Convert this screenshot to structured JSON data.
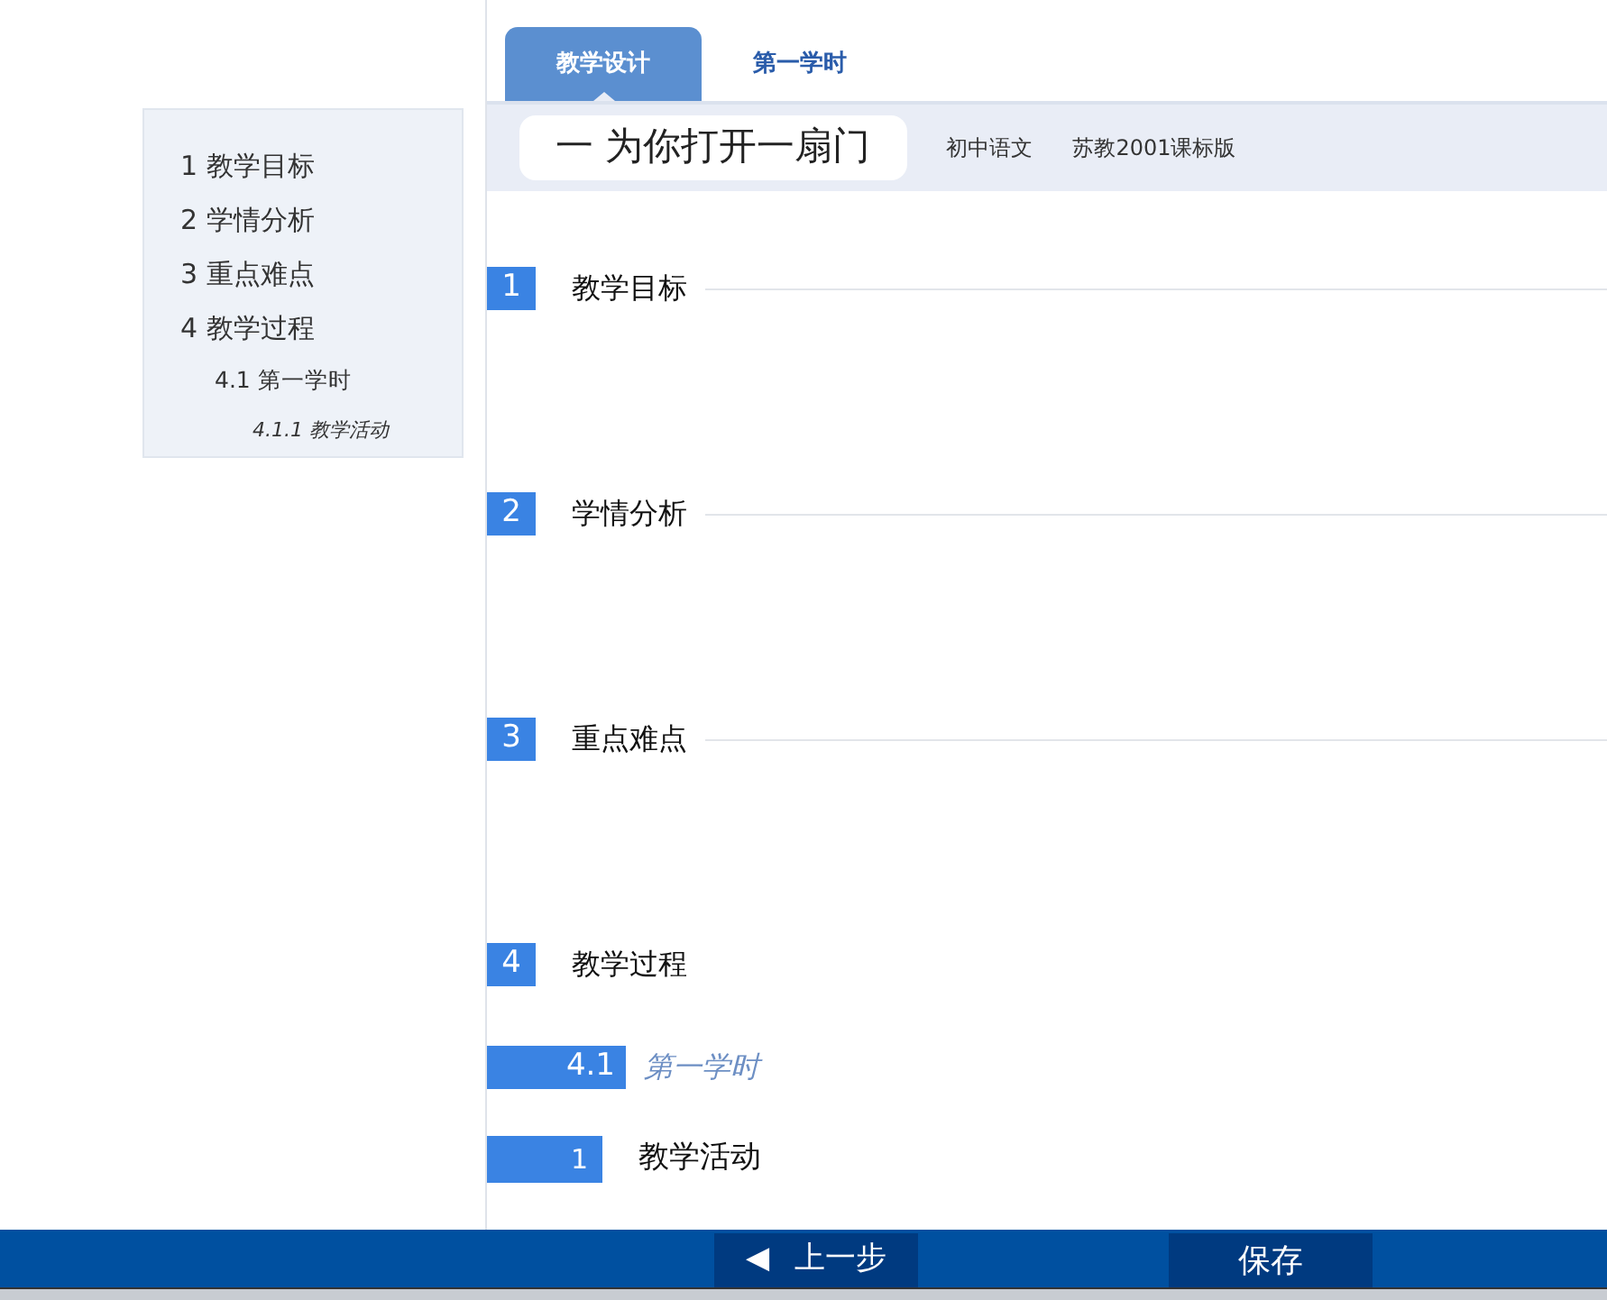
{
  "tabs": [
    {
      "label": "教学设计",
      "selected": true
    },
    {
      "label": "第一学时",
      "selected": false
    }
  ],
  "outline": [
    {
      "label": "1 教学目标"
    },
    {
      "label": "2 学情分析"
    },
    {
      "label": "3 重点难点"
    },
    {
      "label": "4 教学过程",
      "children": [
        {
          "label": "4.1 第一学时",
          "children": [
            {
              "label": "4.1.1 教学活动"
            }
          ]
        }
      ]
    }
  ],
  "header": {
    "title": "一 为你打开一扇门",
    "subject": "初中语文",
    "edition": "苏教2001课标版"
  },
  "sections": [
    {
      "kind": "section",
      "number": "1",
      "title": "教学目标",
      "divider": true
    },
    {
      "kind": "section",
      "number": "2",
      "title": "学情分析",
      "divider": true
    },
    {
      "kind": "section",
      "number": "3",
      "title": "重点难点",
      "divider": true
    },
    {
      "kind": "section",
      "number": "4",
      "title": "教学过程",
      "divider": false
    },
    {
      "kind": "lesson",
      "number": "4.1",
      "title": "第一学时"
    },
    {
      "kind": "activity",
      "number": "1",
      "title": "教学活动"
    }
  ],
  "footer": {
    "buttons": [
      {
        "kind": "back",
        "icon": "◀",
        "label": "上一步"
      },
      {
        "kind": "save",
        "label": "保存"
      }
    ]
  }
}
